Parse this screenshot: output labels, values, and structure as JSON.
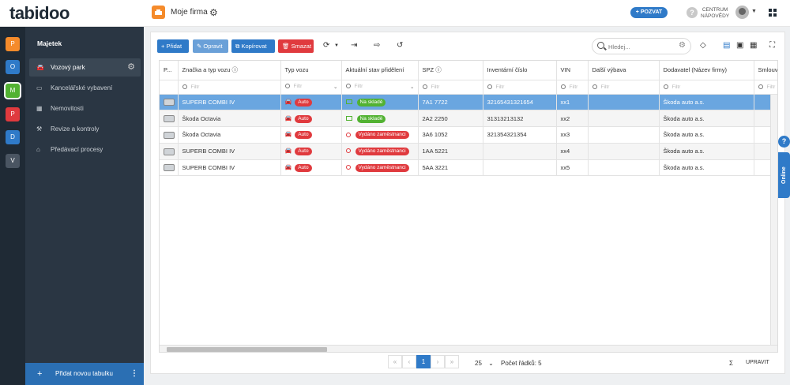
{
  "header": {
    "logo": "tabidoo",
    "firm_name": "Moje firma",
    "invite_label": "+ POZVAT",
    "help_line1": "CENTRUM",
    "help_line2": "NÁPOVĚDY",
    "help_icon": "?"
  },
  "rail": [
    {
      "letter": "P",
      "color": "#f58b2b"
    },
    {
      "letter": "O",
      "color": "#2f7ac8"
    },
    {
      "letter": "M",
      "color": "#52b232"
    },
    {
      "letter": "P",
      "color": "#e03a3e"
    },
    {
      "letter": "D",
      "color": "#2f7ac8"
    },
    {
      "letter": "V",
      "color": "#4a5562"
    }
  ],
  "sidebar": {
    "title": "Majetek",
    "items": [
      {
        "label": "Vozový park",
        "icon": "car-icon"
      },
      {
        "label": "Kancelářské vybavení",
        "icon": "monitor-icon"
      },
      {
        "label": "Nemovitosti",
        "icon": "building-icon"
      },
      {
        "label": "Revize a kontroly",
        "icon": "wrench-icon"
      },
      {
        "label": "Předávací procesy",
        "icon": "handover-icon"
      }
    ],
    "footer_label": "Přidat novou tabulku",
    "footer_plus": "+",
    "footer_more": "⋮"
  },
  "toolbar": {
    "add": "+ Přidat",
    "edit": "✎ Opravit",
    "copy": "⧉ Kopírovat",
    "delete": "🗑 Smazat",
    "search_placeholder": "Hledej..."
  },
  "table": {
    "columns": [
      "P...",
      "Značka a typ vozu",
      "Typ vozu",
      "Aktuální stav přidělení",
      "SPZ",
      "Inventární číslo",
      "VIN",
      "Další výbava",
      "Dodavatel (Název firmy)",
      "Smlouva"
    ],
    "filter_placeholder": "Filtr",
    "rows": [
      {
        "brand": "SUPERB COMBI IV",
        "type": "Auto",
        "status": "Na skladě",
        "status_color": "#52b232",
        "spz": "7A1 7722",
        "inv": "32165431321654",
        "vin": "xx1",
        "extra": "",
        "supplier": "Škoda auto a.s."
      },
      {
        "brand": "Škoda Octavia",
        "type": "Auto",
        "status": "Na skladě",
        "status_color": "#52b232",
        "spz": "2A2 2250",
        "inv": "31313213132",
        "vin": "xx2",
        "extra": "",
        "supplier": "Škoda auto a.s."
      },
      {
        "brand": "Škoda Octavia",
        "type": "Auto",
        "status": "Vydáno zaměstnanci",
        "status_color": "#e03a3e",
        "spz": "3A6 1052",
        "inv": "321354321354",
        "vin": "xx3",
        "extra": "",
        "supplier": "Škoda auto a.s."
      },
      {
        "brand": "SUPERB COMBI IV",
        "type": "Auto",
        "status": "Vydáno zaměstnanci",
        "status_color": "#e03a3e",
        "spz": "1AA 5221",
        "inv": "",
        "vin": "xx4",
        "extra": "",
        "supplier": "Škoda auto a.s."
      },
      {
        "brand": "SUPERB COMBI IV",
        "type": "Auto",
        "status": "Vydáno zaměstnanci",
        "status_color": "#e03a3e",
        "spz": "5AA 3221",
        "inv": "",
        "vin": "xx5",
        "extra": "",
        "supplier": "Škoda auto a.s."
      }
    ]
  },
  "pager": {
    "current_page": "1",
    "page_size": "25",
    "row_count": "Počet řádků: 5",
    "sum_symbol": "Σ",
    "edit_label": "UPRAVIT"
  },
  "side": {
    "online_label": "Online",
    "help": "?"
  }
}
